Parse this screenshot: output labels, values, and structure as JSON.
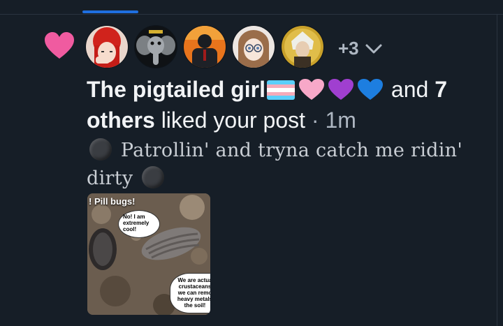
{
  "colors": {
    "background": "#161e27",
    "accent": "#1f6fe0",
    "like_heart": "#f05ba0",
    "secondary_text": "#aeb7c2"
  },
  "notification": {
    "icon": "heart-icon",
    "avatars": [
      {
        "name": "avatar-red-haired-girl"
      },
      {
        "name": "avatar-elephant"
      },
      {
        "name": "avatar-suited-figure"
      },
      {
        "name": "avatar-anime-girl-glasses"
      },
      {
        "name": "avatar-white-haired-character"
      }
    ],
    "more_count": "+3",
    "actor_name": "The pigtailed girl",
    "and_text": "and",
    "others_count": "7",
    "others_word": "others",
    "action_text": "liked your post",
    "separator": "·",
    "time_ago": "1m"
  },
  "post": {
    "text_main": "Patrollin' and tryna catch me ridin'",
    "text_end": "dirty",
    "image": {
      "title": "! Pill bugs!",
      "bubble_top": "No! I am extremely cool!",
      "bubble_bottom": "We are actua crustaceans we can remo heavy metals the soil!"
    }
  }
}
